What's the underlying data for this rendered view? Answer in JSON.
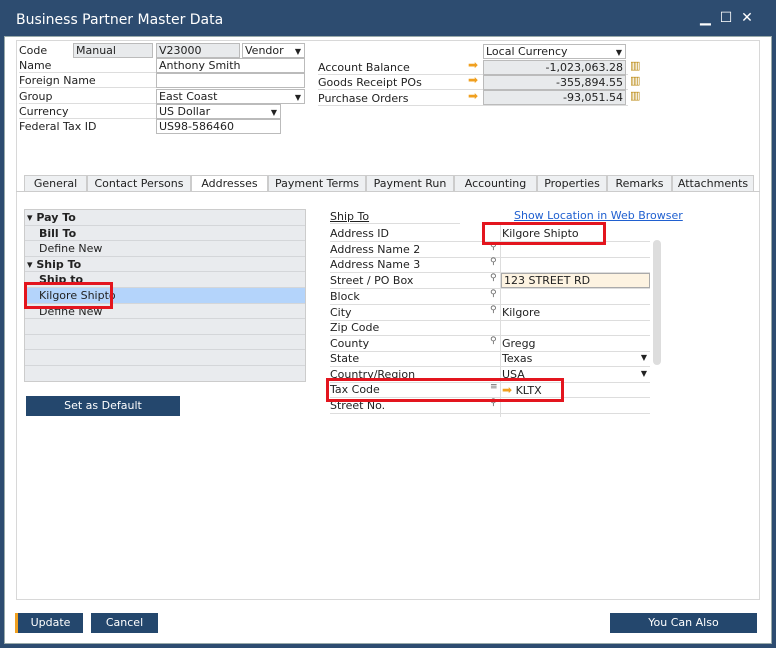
{
  "window": {
    "title": "Business Partner Master Data"
  },
  "header": {
    "code_label": "Code",
    "code_series": "Manual",
    "code_value": "V23000",
    "type": "Vendor",
    "name_label": "Name",
    "name_value": "Anthony Smith",
    "foreign_label": "Foreign Name",
    "foreign_value": "",
    "group_label": "Group",
    "group_value": "East Coast",
    "currency_label": "Currency",
    "currency_value": "US Dollar",
    "taxid_label": "Federal Tax ID",
    "taxid_value": "US98-586460",
    "currency_view": "Local Currency",
    "balances": [
      {
        "label": "Account Balance",
        "value": "-1,023,063.28"
      },
      {
        "label": "Goods Receipt POs",
        "value": "-355,894.55"
      },
      {
        "label": "Purchase Orders",
        "value": "-93,051.54"
      }
    ]
  },
  "tabs": [
    "General",
    "Contact Persons",
    "Addresses",
    "Payment Terms",
    "Payment Run",
    "Accounting",
    "Properties",
    "Remarks",
    "Attachments"
  ],
  "address_list": [
    {
      "label": "Pay To",
      "bold": true,
      "group": true
    },
    {
      "label": "Bill To",
      "bold": true
    },
    {
      "label": "Define New"
    },
    {
      "label": "Ship To",
      "bold": true,
      "group": true
    },
    {
      "label": "Ship to",
      "bold": true
    },
    {
      "label": "Kilgore Shipto",
      "selected": true
    },
    {
      "label": "Define New"
    }
  ],
  "set_default": "Set as Default",
  "detail": {
    "section": "Ship To",
    "link": "Show Location in Web Browser",
    "rows": [
      {
        "label": "Address ID",
        "value": "Kilgore Shipto"
      },
      {
        "label": "Address Name 2",
        "value": ""
      },
      {
        "label": "Address Name 3",
        "value": ""
      },
      {
        "label": "Street / PO Box",
        "value": "123 STREET RD"
      },
      {
        "label": "Block",
        "value": ""
      },
      {
        "label": "City",
        "value": "Kilgore"
      },
      {
        "label": "Zip Code",
        "value": ""
      },
      {
        "label": "County",
        "value": "Gregg"
      },
      {
        "label": "State",
        "value": "Texas"
      },
      {
        "label": "Country/Region",
        "value": "USA"
      },
      {
        "label": "Tax Code",
        "value": "KLTX"
      },
      {
        "label": "Street No.",
        "value": ""
      }
    ]
  },
  "footer": {
    "update": "Update",
    "cancel": "Cancel",
    "you_can_also": "You Can Also"
  }
}
